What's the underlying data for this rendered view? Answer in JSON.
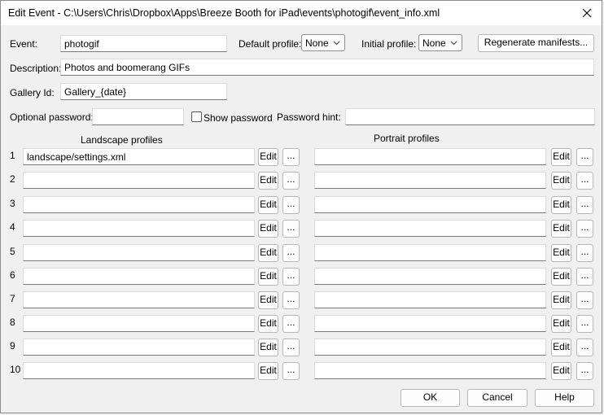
{
  "window": {
    "title": "Edit Event - C:\\Users\\Chris\\Dropbox\\Apps\\Breeze Booth for iPad\\events\\photogif\\event_info.xml"
  },
  "event": {
    "label": "Event:",
    "value": "photogif"
  },
  "default_profile": {
    "label": "Default profile:",
    "value": "None"
  },
  "initial_profile": {
    "label": "Initial profile:",
    "value": "None"
  },
  "regenerate_button": "Regenerate manifests...",
  "description": {
    "label": "Description:",
    "value": "Photos and boomerang GIFs"
  },
  "gallery_id": {
    "label": "Gallery Id:",
    "value": "Gallery_{date}"
  },
  "password": {
    "label": "Optional password:",
    "value": "",
    "show_label": "Show password",
    "hint_label": "Password hint:",
    "hint_value": ""
  },
  "profiles": {
    "landscape_header": "Landscape profiles",
    "portrait_header": "Portrait profiles",
    "edit_label": "Edit",
    "browse_label": "...",
    "rows": [
      {
        "num": "1",
        "landscape": "landscape/settings.xml",
        "portrait": ""
      },
      {
        "num": "2",
        "landscape": "",
        "portrait": ""
      },
      {
        "num": "3",
        "landscape": "",
        "portrait": ""
      },
      {
        "num": "4",
        "landscape": "",
        "portrait": ""
      },
      {
        "num": "5",
        "landscape": "",
        "portrait": ""
      },
      {
        "num": "6",
        "landscape": "",
        "portrait": ""
      },
      {
        "num": "7",
        "landscape": "",
        "portrait": ""
      },
      {
        "num": "8",
        "landscape": "",
        "portrait": ""
      },
      {
        "num": "9",
        "landscape": "",
        "portrait": ""
      },
      {
        "num": "10",
        "landscape": "",
        "portrait": ""
      }
    ]
  },
  "footer": {
    "ok": "OK",
    "cancel": "Cancel",
    "help": "Help"
  },
  "icons": {
    "close": "close-icon",
    "dropdown": "chevron-down-icon"
  }
}
